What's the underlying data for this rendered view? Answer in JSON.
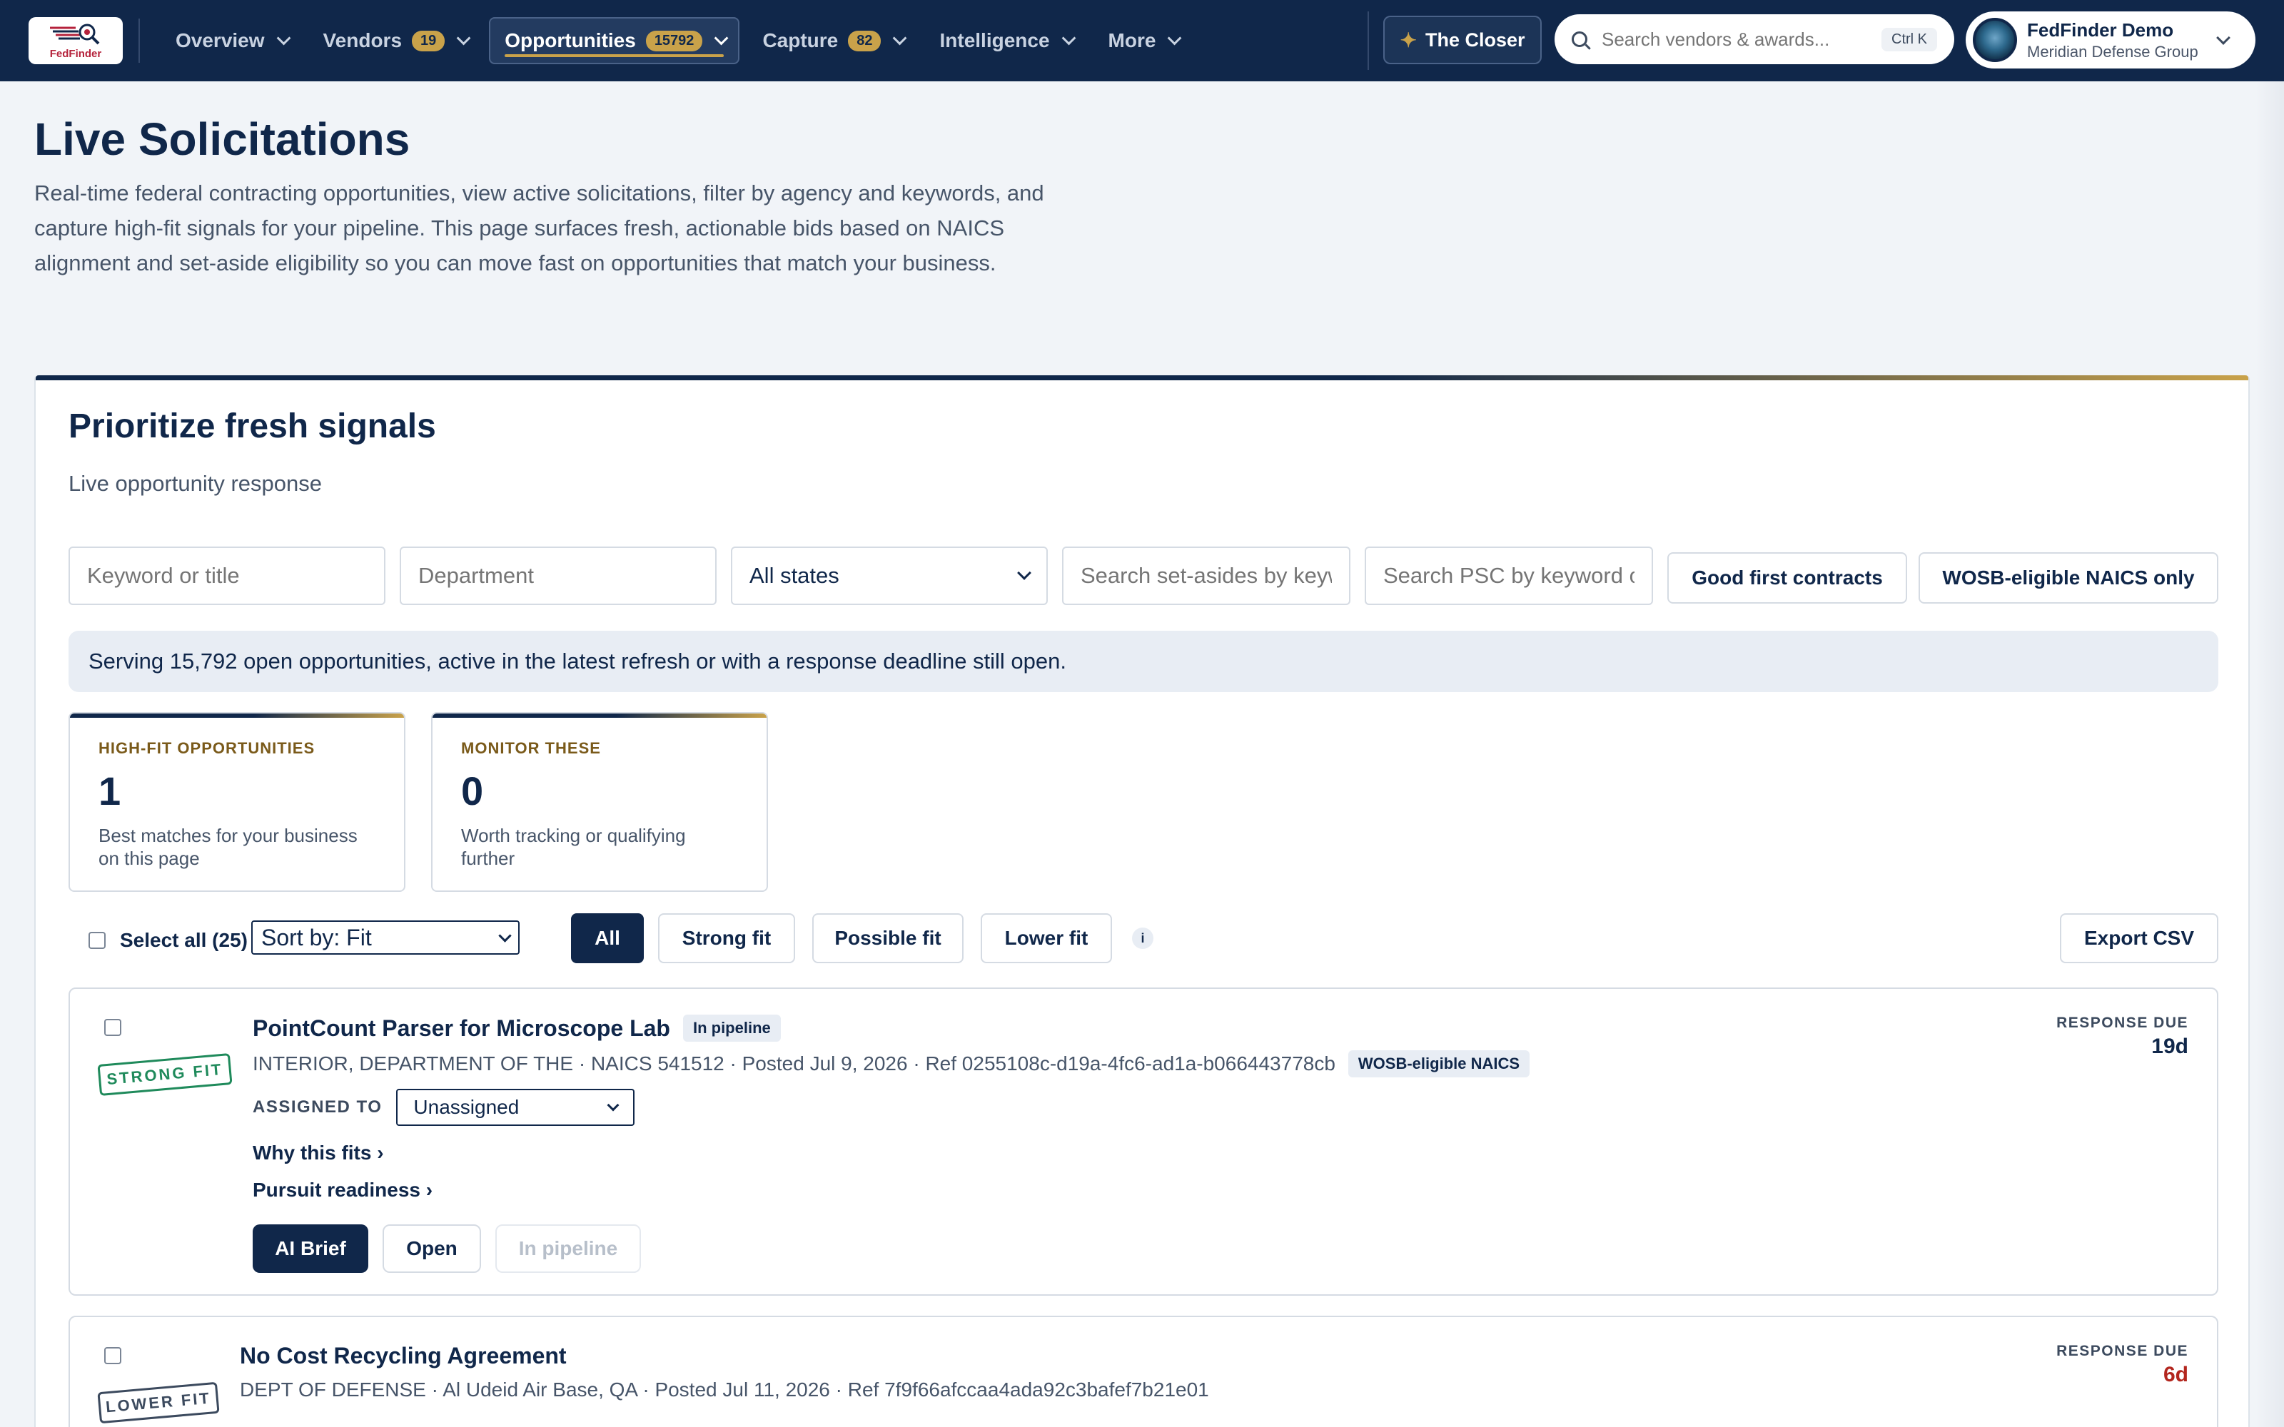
{
  "nav": {
    "logo_text": "FedFinder",
    "items": [
      {
        "label": "Overview",
        "badge": null
      },
      {
        "label": "Vendors",
        "badge": "19"
      },
      {
        "label": "Opportunities",
        "badge": "15792"
      },
      {
        "label": "Capture",
        "badge": "82"
      },
      {
        "label": "Intelligence",
        "badge": null
      },
      {
        "label": "More",
        "badge": null
      }
    ],
    "closer_label": "The Closer",
    "search_placeholder": "Search vendors & awards...",
    "search_shortcut": "Ctrl K",
    "user_name": "FedFinder Demo",
    "user_org": "Meridian Defense Group"
  },
  "header": {
    "title": "Live Solicitations",
    "description": "Real-time federal contracting opportunities, view active solicitations, filter by agency and keywords, and capture high-fit signals for your pipeline. This page surfaces fresh, actionable bids based on NAICS alignment and set-aside eligibility so you can move fast on opportunities that match your business."
  },
  "card": {
    "title": "Prioritize fresh signals",
    "subtitle": "Live opportunity response",
    "filters": {
      "keyword_placeholder": "Keyword or title",
      "department_placeholder": "Department",
      "state_value": "All states",
      "setaside_placeholder": "Search set-asides by keyw",
      "psc_placeholder": "Search PSC by keyword or",
      "good_first_label": "Good first contracts",
      "wosb_label": "WOSB-eligible NAICS only"
    },
    "banner": "Serving 15,792 open opportunities, active in the latest refresh or with a response deadline still open.",
    "stats": [
      {
        "label": "HIGH-FIT OPPORTUNITIES",
        "value": "1",
        "desc": "Best matches for your business on this page"
      },
      {
        "label": "MONITOR THESE",
        "value": "0",
        "desc": "Worth tracking or qualifying further"
      }
    ]
  },
  "toolbar": {
    "select_all": "Select all (25)",
    "sort_value": "Sort by: Fit",
    "segments": [
      "All",
      "Strong fit",
      "Possible fit",
      "Lower fit"
    ],
    "info": "i",
    "export": "Export CSV"
  },
  "opportunities": [
    {
      "fit": "STRONG FIT",
      "title": "PointCount Parser for Microscope Lab",
      "status_tag": "In pipeline",
      "meta": "INTERIOR, DEPARTMENT OF THE · NAICS 541512 · Posted Jul 9, 2026 · Ref 0255108c-d19a-4fc6-ad1a-b066443778cb",
      "meta_tag": "WOSB-eligible NAICS",
      "assigned_label": "ASSIGNED TO",
      "assigned_value": "Unassigned",
      "why_fits": "Why this fits ›",
      "readiness": "Pursuit readiness ›",
      "ai_brief": "AI Brief",
      "open": "Open",
      "in_pipeline": "In pipeline",
      "due_label": "RESPONSE DUE",
      "due_value": "19d",
      "due_color": "#10274a"
    },
    {
      "fit": "LOWER FIT",
      "title": "No Cost Recycling Agreement",
      "meta": "DEPT OF DEFENSE · Al Udeid Air Base, QA · Posted Jul 11, 2026 · Ref 7f9f66afccaa4ada92c3bafef7b21e01",
      "due_label": "RESPONSE DUE",
      "due_value": "6d",
      "due_color": "#b3261e"
    }
  ]
}
